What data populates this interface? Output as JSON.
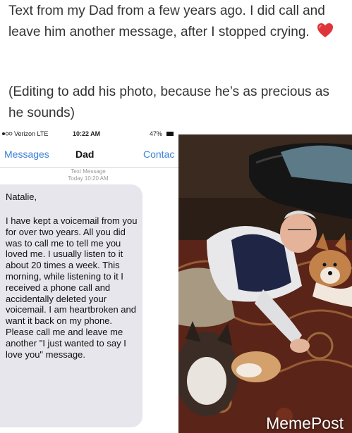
{
  "caption": {
    "line1": "Text from my Dad from a few years ago.  I did call and leave him another message, after I stopped crying.",
    "line2": "(Editing to add his photo, because he’s as precious as he sounds)"
  },
  "status_bar": {
    "carrier": "Verizon  LTE",
    "time": "10:22 AM",
    "battery": "47%"
  },
  "nav": {
    "back_label": "Messages",
    "title": "Dad",
    "contact_label": "Contac"
  },
  "message_meta": {
    "type": "Text Message",
    "timestamp": "Today 10:20 AM"
  },
  "message": {
    "greeting": "Natalie,",
    "body": "I have kept a voicemail from you for over two years.  All you did was to call me to tell me you loved me.  I usually listen to it about 20 times a week.  This morning, while listening to it I received a phone call and accidentally deleted your voicemail.  I am heartbroken and want it back on my phone.  Please call me and leave me another \"I just wanted to say I love you\" message."
  },
  "watermark": "MemePost",
  "colors": {
    "heart": "#e0343b",
    "ios_blue": "#3b82d8",
    "bubble": "#e6e6ec"
  },
  "icons": [
    "red-heart-icon",
    "signal-dots-icon",
    "battery-icon"
  ]
}
